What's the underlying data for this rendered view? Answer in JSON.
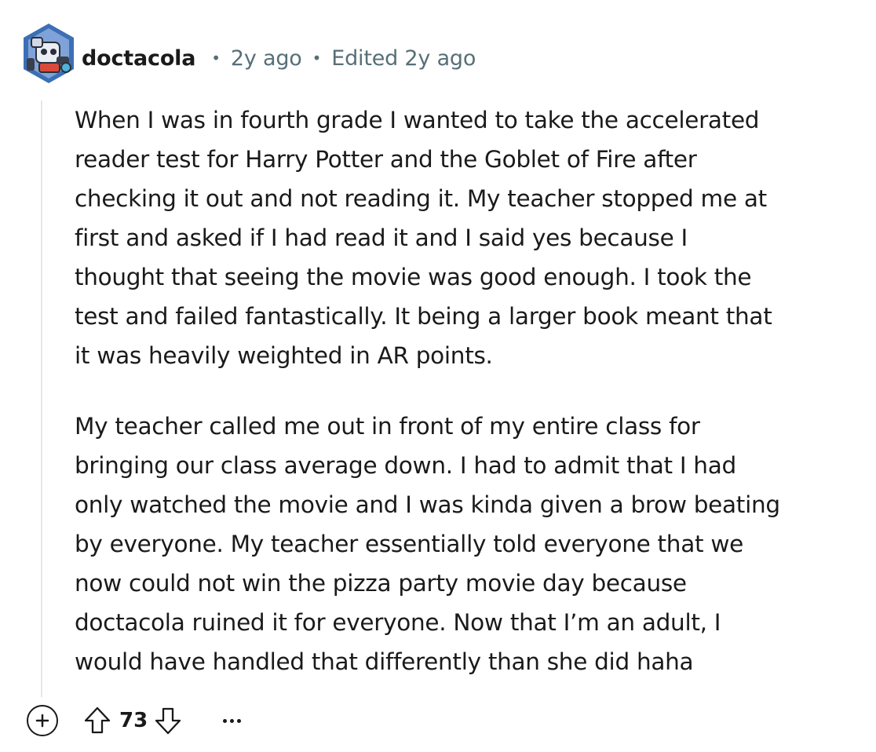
{
  "comment": {
    "author": "doctacola",
    "time": "2y ago",
    "edited": "Edited 2y ago",
    "paragraphs": [
      [
        "When I was in fourth grade I wanted to take the accelerated",
        "reader test for Harry Potter and the Goblet of Fire after",
        "checking it out and not reading it. My teacher stopped me at",
        "first and asked if I had read it and I said yes because I",
        "thought that seeing the movie was good enough. I took the",
        "test and failed fantastically. It being a larger book meant that",
        "it was heavily weighted in AR points."
      ],
      [
        "My teacher called me out in front of my entire class for",
        "bringing our class average down. I had to admit that I had",
        "only watched the movie and I was kinda given a brow beating",
        "by everyone. My teacher essentially told everyone that we",
        "now could not win the pizza party movie day because",
        "doctacola ruined it for everyone. Now that I’m an adult, I",
        "would have handled that differently than she did haha"
      ]
    ],
    "score": "73"
  },
  "icons": {
    "avatar": "snoo-avatar",
    "expand": "plus-icon",
    "upvote": "upvote-arrow-icon",
    "downvote": "downvote-arrow-icon",
    "more": "ellipsis-icon"
  },
  "colors": {
    "text": "#1a1a1b",
    "meta": "#576f76",
    "thread_line": "#e2e7e9"
  }
}
